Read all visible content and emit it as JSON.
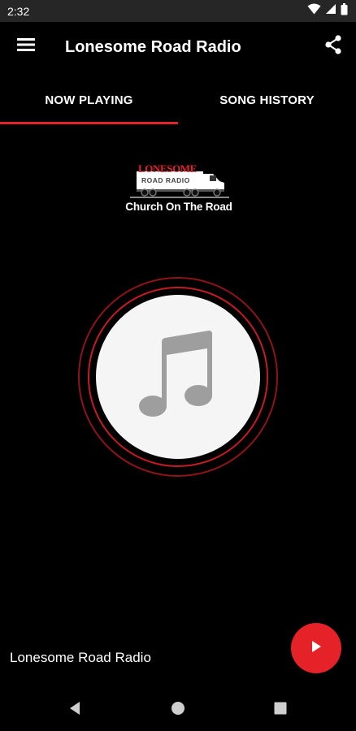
{
  "status_bar": {
    "time": "2:32",
    "icons": [
      "wifi-icon",
      "signal-icon",
      "battery-icon"
    ]
  },
  "app_bar": {
    "title": "Lonesome Road Radio",
    "menu_icon": "menu-icon",
    "share_icon": "share-icon"
  },
  "tabs": [
    {
      "label": "NOW PLAYING",
      "active": true
    },
    {
      "label": "SONG HISTORY",
      "active": false
    }
  ],
  "logo": {
    "text_top": "LONESOME",
    "text_bottom": "ROAD RADIO",
    "tagline": "Church On The Road"
  },
  "album_art": {
    "icon": "music-note-icon"
  },
  "player": {
    "station_name": "Lonesome Road Radio",
    "play_icon": "play-icon"
  },
  "nav": {
    "icons": [
      "back-icon",
      "home-icon",
      "recents-icon"
    ]
  },
  "colors": {
    "accent": "#e2232a",
    "background": "#000000",
    "status_bar": "#262626",
    "disc": "#f5f5f5",
    "note": "#9e9e9e"
  }
}
